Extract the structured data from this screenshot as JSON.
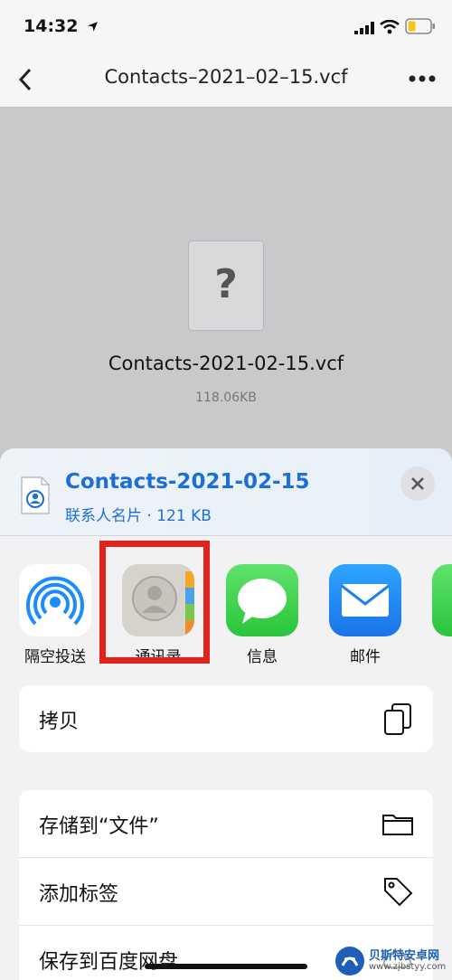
{
  "status": {
    "time": "14:32"
  },
  "nav": {
    "title": "Contacts–2021–02–15.vcf"
  },
  "preview": {
    "placeholder": "?",
    "filename": "Contacts-2021-02-15.vcf",
    "size": "118.06KB"
  },
  "sheet": {
    "title": "Contacts-2021-02-15",
    "subtitle": "联系人名片 · 121 KB",
    "apps": [
      {
        "label": "隔空投送",
        "icon": "airdrop-icon"
      },
      {
        "label": "通讯录",
        "icon": "contacts-icon"
      },
      {
        "label": "信息",
        "icon": "messages-icon"
      },
      {
        "label": "邮件",
        "icon": "mail-icon"
      }
    ],
    "actions_group1": [
      {
        "label": "拷贝",
        "icon": "copy-icon"
      }
    ],
    "actions_group2": [
      {
        "label": "存储到“文件”",
        "icon": "folder-icon"
      },
      {
        "label": "添加标签",
        "icon": "tag-icon"
      },
      {
        "label": "保存到百度网盘",
        "icon": "cloud-icon"
      }
    ]
  },
  "watermark": {
    "name": "贝斯特安卓网",
    "url": "www.zjbstyy.com"
  },
  "colors": {
    "accent": "#1b6fd7",
    "highlight": "#e0241b",
    "messages": "#34c759",
    "mail": "#1a8cff"
  }
}
